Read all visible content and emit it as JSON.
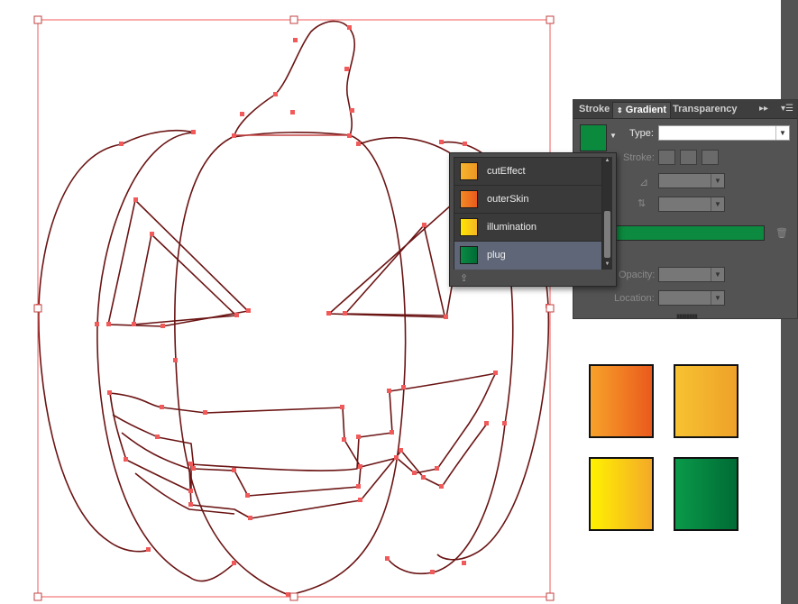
{
  "panel": {
    "tabs": [
      "Stroke",
      "Gradient",
      "Transparency"
    ],
    "type_label": "Type:",
    "stroke_label": "Stroke:",
    "opacity_label": "Opacity:",
    "location_label": "Location:",
    "gradient_color": "#0c8a3f"
  },
  "swatch_popup": {
    "items": [
      {
        "name": "cutEffect",
        "color": "#f0a020"
      },
      {
        "name": "outerSkin",
        "color": "#ee6a1c"
      },
      {
        "name": "illumination",
        "color": "#f7c51a"
      },
      {
        "name": "plug",
        "color": "#0b7a3b"
      }
    ],
    "selected": "plug"
  },
  "canvas_swatches": [
    {
      "name": "outerSkin",
      "from": "#f7a22a",
      "to": "#ea5a1d"
    },
    {
      "name": "cutEffect",
      "from": "#f7c231",
      "to": "#eea129"
    },
    {
      "name": "illumination",
      "from": "#fff200",
      "to": "#f4a928"
    },
    {
      "name": "plug",
      "from": "#0a9a4a",
      "to": "#006b35"
    }
  ],
  "colors": {
    "selection": "#f05a5a",
    "path": "#6b1414",
    "panel_bg": "#535353"
  }
}
